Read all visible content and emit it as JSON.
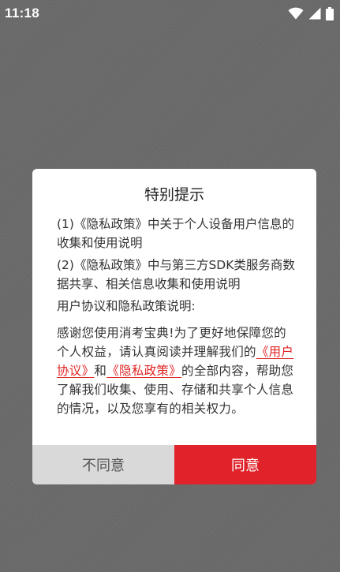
{
  "status_bar": {
    "time": "11:18",
    "icons": [
      "wifi-icon",
      "cellular-signal-icon",
      "battery-icon"
    ]
  },
  "dialog": {
    "title": "特别提示",
    "item1": "(1)《隐私政策》中关于个人设备用户信息的收集和使用说明",
    "item2": "(2)《隐私政策》中与第三方SDK类服务商数据共享、相关信息收集和使用说明",
    "item3": "用户协议和隐私政策说明:",
    "body": {
      "before": "感谢您使用消考宝典!为了更好地保障您的个人权益，请认真阅读并理解我们的",
      "link_user_agreement": "《用户协议》",
      "and": "和",
      "link_privacy_policy": "《隐私政策》",
      "after": "的全部内容，帮助您了解我们收集、使用、存储和共享个人信息的情况，以及您享有的相关权力。"
    },
    "buttons": {
      "disagree": "不同意",
      "agree": "同意"
    }
  },
  "colors": {
    "accent": "#e0222a",
    "link": "#e02424",
    "disagree_bg": "#d9d9d9",
    "overlay_bg": "#6a6a6a"
  }
}
